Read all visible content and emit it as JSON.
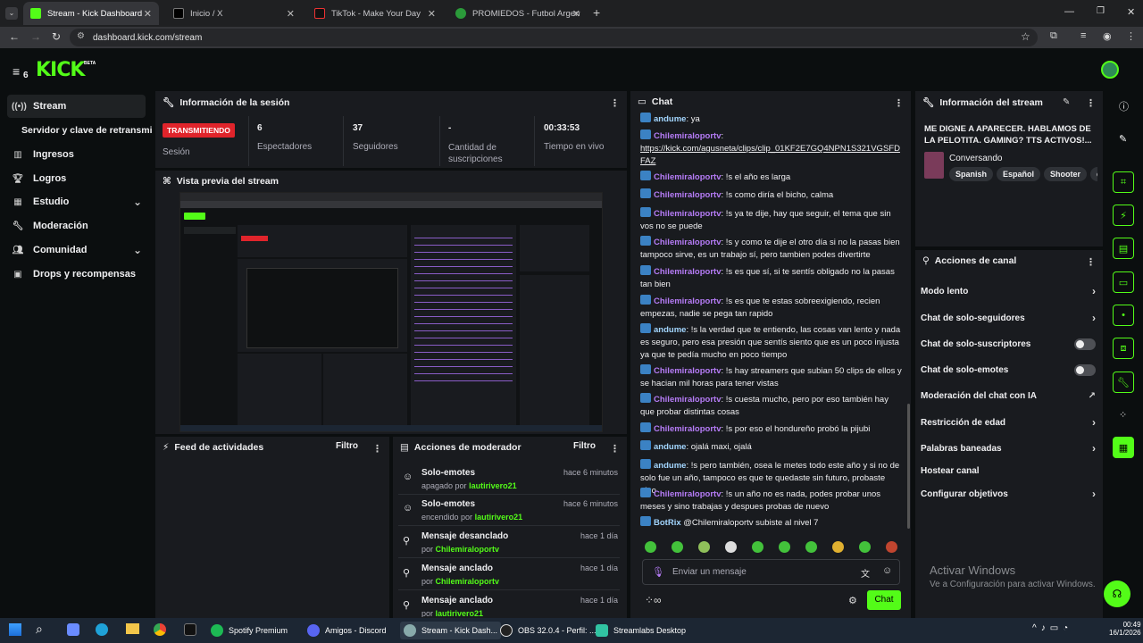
{
  "browser": {
    "tabs": [
      {
        "label": "Stream - Kick Dashboard",
        "active": true
      },
      {
        "label": "Inicio / X"
      },
      {
        "label": "TikTok - Make Your Day"
      },
      {
        "label": "PROMIEDOS - Futbol Argentino"
      }
    ],
    "url": "dashboard.kick.com/stream"
  },
  "header": {
    "logo": "KICK",
    "beta": "BETA",
    "badge": "6"
  },
  "sidebar": {
    "items": [
      {
        "label": "Stream",
        "icon": "broadcast-icon"
      },
      {
        "label": "Servidor y clave de retransmisión"
      },
      {
        "label": "Ingresos",
        "icon": "bar-chart-icon"
      },
      {
        "label": "Logros",
        "icon": "trophy-icon"
      },
      {
        "label": "Estudio",
        "icon": "grid-icon"
      },
      {
        "label": "Moderación",
        "icon": "wrench-icon"
      },
      {
        "label": "Comunidad",
        "icon": "people-icon"
      },
      {
        "label": "Drops y recompensas",
        "icon": "gift-icon"
      }
    ]
  },
  "session": {
    "title": "Información de la sesión",
    "status": "TRANSMITIENDO",
    "status_label": "Sesión",
    "stats": [
      {
        "value": "6",
        "label": "Espectadores"
      },
      {
        "value": "37",
        "label": "Seguidores"
      },
      {
        "value": "-",
        "label": "Cantidad de suscripciones"
      },
      {
        "value": "00:33:53",
        "label": "Tiempo en vivo"
      }
    ]
  },
  "preview": {
    "title": "Vista previa del stream"
  },
  "activity": {
    "title": "Feed de actividades",
    "filter": "Filtro"
  },
  "modactions": {
    "title": "Acciones de moderador",
    "filter": "Filtro",
    "items": [
      {
        "title": "Solo-emotes",
        "sub": "apagado por",
        "user": "lautirivero21",
        "time": "hace 6 minutos"
      },
      {
        "title": "Solo-emotes",
        "sub": "encendido por",
        "user": "lautirivero21",
        "time": "hace 6 minutos"
      },
      {
        "title": "Mensaje desanclado",
        "sub": "por",
        "user": "Chilemiraloportv",
        "time": "hace 1 día"
      },
      {
        "title": "Mensaje anclado",
        "sub": "por",
        "user": "Chilemiraloportv",
        "time": "hace 1 día"
      },
      {
        "title": "Mensaje anclado",
        "sub": "por",
        "user": "lautirivero21",
        "time": "hace 1 día"
      }
    ]
  },
  "chat": {
    "title": "Chat",
    "placeholder": "Enviar un mensaje",
    "send": "Chat",
    "messages": [
      {
        "user": "andume",
        "text": "ya"
      },
      {
        "user": "Chilemiraloportv",
        "text": "https://kick.com/agusneta/clips/clip_01KF2E7GQ4NPN1S321VGSFDFAZ"
      },
      {
        "user": "Chilemiraloportv",
        "text": "!s el año es larga"
      },
      {
        "user": "Chilemiraloportv",
        "text": "!s como diría el bicho, calma"
      },
      {
        "user": "Chilemiraloportv",
        "text": "!s ya te dije, hay que seguir, el tema que sin vos no se puede"
      },
      {
        "user": "Chilemiraloportv",
        "text": "!s y como te dije el otro día si no la pasas bien tampoco sirve, es un trabajo sí, pero tambien podes divertirte"
      },
      {
        "user": "Chilemiraloportv",
        "text": "!s es que sí, si te sentís obligado no la pasas tan bien"
      },
      {
        "user": "Chilemiraloportv",
        "text": "!s es que te estas sobreexigiendo, recien empezas, nadie se pega tan rapido"
      },
      {
        "user": "andume",
        "text": "!s la verdad que te entiendo, las cosas van lento y nada es seguro, pero esa presión que sentís siento que es un poco injusta ya que te pedía mucho en poco tiempo"
      },
      {
        "user": "Chilemiraloportv",
        "text": "!s hay streamers que subian 50 clips de ellos y se hacian mil horas para tener vistas"
      },
      {
        "user": "Chilemiraloportv",
        "text": "!s cuesta mucho, pero por eso también hay que probar distintas cosas"
      },
      {
        "user": "Chilemiraloportv",
        "text": "!s por eso el hondureño probó la pijubi"
      },
      {
        "user": "andume",
        "text": "ojalá maxi, ojalá"
      },
      {
        "user": "andume",
        "text": "!s pero también, osea le metes todo este año y si no de solo fue un año, tampoco es que te quedaste sin futuro, probaste algo"
      },
      {
        "user": "Chilemiraloportv",
        "text": "!s un año no es nada, podes probar unos meses y sino trabajas y despues probas de nuevo"
      },
      {
        "user": "BotRix",
        "text": "@Chilemiraloportv subiste al nivel 7"
      }
    ]
  },
  "streaminfo": {
    "title": "Información del stream",
    "stream_title": "ME DIGNE A APARECER. HABLAMOS DE LA PELOTITA. GAMING? TTS ACTIVOS!...",
    "category": "Conversando",
    "tags": [
      "Spanish",
      "Español",
      "Shooter",
      "chill"
    ]
  },
  "channelactions": {
    "title": "Acciones de canal",
    "items": [
      {
        "label": "Modo lento",
        "ctrl": "chevron"
      },
      {
        "label": "Chat de solo-seguidores",
        "ctrl": "chevron"
      },
      {
        "label": "Chat de solo-suscriptores",
        "ctrl": "toggle"
      },
      {
        "label": "Chat de solo-emotes",
        "ctrl": "toggle"
      },
      {
        "label": "Moderación del chat con IA",
        "ctrl": "external"
      },
      {
        "label": "Restricción de edad",
        "ctrl": "chevron"
      },
      {
        "label": "Palabras baneadas",
        "ctrl": "chevron"
      },
      {
        "label": "Hostear canal",
        "ctrl": "none"
      },
      {
        "label": "Configurar objetivos",
        "ctrl": "chevron"
      }
    ]
  },
  "watermark": {
    "line1": "Activar Windows",
    "line2": "Ve a Configuración para activar Windows."
  },
  "taskbar": {
    "apps": [
      "Spotify Premium",
      "Amigos - Discord",
      "Stream - Kick Dash...",
      "OBS 32.0.4 - Perfil: ...",
      "Streamlabs Desktop"
    ],
    "time": "00:49",
    "date": "16/1/2026"
  },
  "colors": {
    "brand": "#53fc18",
    "live": "#e0242b",
    "panel": "#191b1f",
    "bg": "#0b0e0f"
  }
}
